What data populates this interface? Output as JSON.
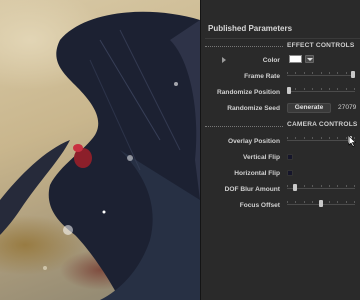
{
  "preview": {
    "description_icon": "abstract-artwork-preview"
  },
  "panel": {
    "title": "Published Parameters",
    "sections": {
      "effect": "EFFECT CONTROLS",
      "camera": "CAMERA CONTROLS"
    },
    "effect": {
      "color_label": "Color",
      "color_value": "#ffffff",
      "frame_rate_label": "Frame Rate",
      "frame_rate_value": 1.0,
      "randomize_position_label": "Randomize Position",
      "randomize_position_value": 0.0,
      "randomize_seed_label": "Randomize Seed",
      "generate_label": "Generate",
      "seed_value": "27079"
    },
    "camera": {
      "overlay_position_label": "Overlay Position",
      "overlay_position_value": 0.95,
      "vertical_flip_label": "Vertical Flip",
      "vertical_flip_checked": false,
      "horizontal_flip_label": "Horizontal Flip",
      "horizontal_flip_checked": false,
      "dof_blur_label": "DOF Blur Amount",
      "dof_blur_value": 0.1,
      "focus_offset_label": "Focus Offset",
      "focus_offset_value": 0.5
    }
  },
  "colors": {
    "panel_bg": "#2a2a2a",
    "thumb": "#c9c9c9",
    "accent_blue": "#5b8fd6"
  }
}
